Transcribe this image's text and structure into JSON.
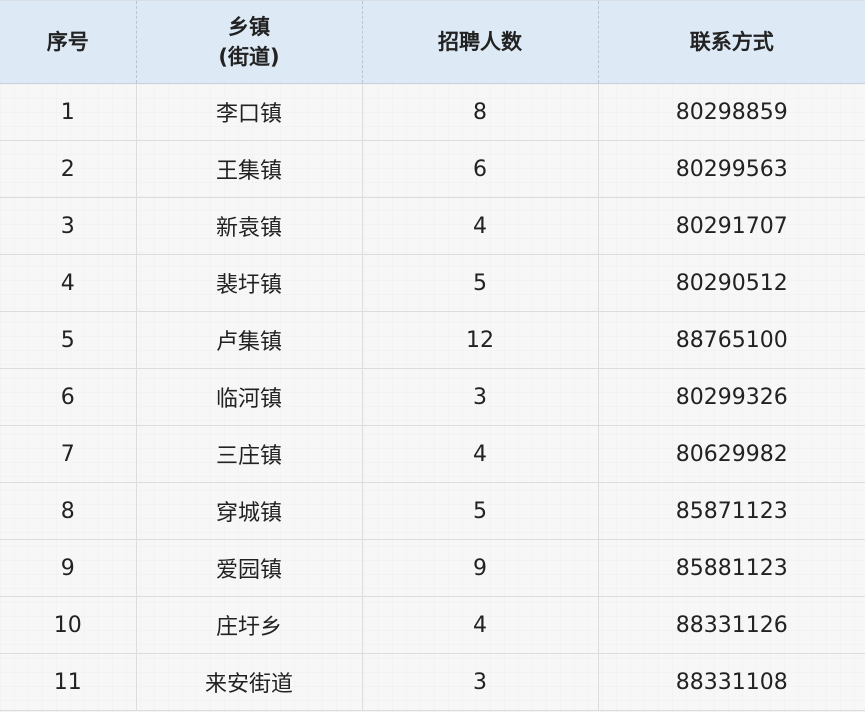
{
  "table": {
    "headers": {
      "index": "序号",
      "town_line1": "乡镇",
      "town_line2": "(街道)",
      "count": "招聘人数",
      "contact": "联系方式"
    },
    "rows": [
      {
        "index": "1",
        "town": "李口镇",
        "count": "8",
        "contact": "80298859"
      },
      {
        "index": "2",
        "town": "王集镇",
        "count": "6",
        "contact": "80299563"
      },
      {
        "index": "3",
        "town": "新袁镇",
        "count": "4",
        "contact": "80291707"
      },
      {
        "index": "4",
        "town": "裴圩镇",
        "count": "5",
        "contact": "80290512"
      },
      {
        "index": "5",
        "town": "卢集镇",
        "count": "12",
        "contact": "88765100"
      },
      {
        "index": "6",
        "town": "临河镇",
        "count": "3",
        "contact": "80299326"
      },
      {
        "index": "7",
        "town": "三庄镇",
        "count": "4",
        "contact": "80629982"
      },
      {
        "index": "8",
        "town": "穿城镇",
        "count": "5",
        "contact": "85871123"
      },
      {
        "index": "9",
        "town": "爱园镇",
        "count": "9",
        "contact": "85881123"
      },
      {
        "index": "10",
        "town": "庄圩乡",
        "count": "4",
        "contact": "88331126"
      },
      {
        "index": "11",
        "town": "来安街道",
        "count": "3",
        "contact": "88331108"
      }
    ]
  },
  "colors": {
    "header_background": "#dde9f5",
    "sheet_background": "#f6f6f6",
    "grid_line": "#dcdcdc"
  }
}
